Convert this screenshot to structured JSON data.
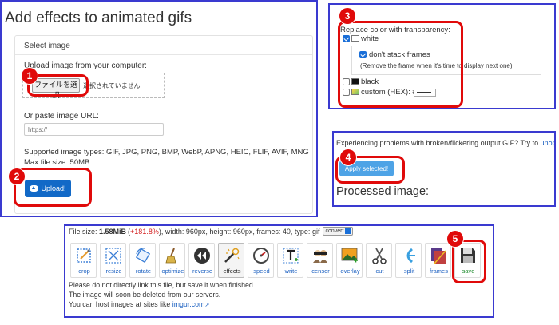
{
  "upload_panel": {
    "title": "Add effects to animated gifs",
    "legend": "Select image",
    "upload_label": "Upload image from your computer:",
    "file_button": "ファイルを選択",
    "file_status": "選択されていません",
    "url_label": "Or paste image URL:",
    "url_placeholder": "https://",
    "supported_types": "Supported image types: GIF, JPG, PNG, BMP, WebP, APNG, HEIC, FLIF, AVIF, MNG",
    "max_size": "Max file size: 50MB",
    "upload_button": "Upload!"
  },
  "transparency_panel": {
    "label": "Replace color with transparency:",
    "white": "white",
    "dont_stack": "don't stack frames",
    "remove_note": "(Remove the frame when it's time to display next one)",
    "black": "black",
    "custom": "custom (HEX): #",
    "checked": {
      "white": true,
      "dont_stack": true,
      "black": false,
      "custom": false
    }
  },
  "apply_panel": {
    "problems_text": "Experiencing problems with broken/flickering output GIF? Try to ",
    "problems_link": "unop",
    "apply_button": "Apply selected!",
    "processed_title": "Processed image:"
  },
  "result_panel": {
    "file_size_label": "File size:",
    "file_size_value": "1.58MiB",
    "size_change": "+181.8%",
    "dimensions_text": ", width: 960px, height: 960px, frames: 40, type: gif",
    "convert_label": "convert",
    "tools": [
      {
        "label": "crop",
        "icon": "crop-icon"
      },
      {
        "label": "resize",
        "icon": "resize-icon"
      },
      {
        "label": "rotate",
        "icon": "rotate-icon"
      },
      {
        "label": "optimize",
        "icon": "optimize-icon"
      },
      {
        "label": "reverse",
        "icon": "reverse-icon"
      },
      {
        "label": "effects",
        "icon": "effects-wand-icon"
      },
      {
        "label": "speed",
        "icon": "speed-icon"
      },
      {
        "label": "write",
        "icon": "write-text-icon"
      },
      {
        "label": "censor",
        "icon": "censor-icon"
      },
      {
        "label": "overlay",
        "icon": "overlay-icon"
      },
      {
        "label": "cut",
        "icon": "scissors-icon"
      },
      {
        "label": "split",
        "icon": "split-icon"
      },
      {
        "label": "frames",
        "icon": "frames-icon"
      },
      {
        "label": "save",
        "icon": "floppy-save-icon"
      }
    ],
    "note1": "Please do not directly link this file, but save it when finished.",
    "note2": "The image will soon be deleted from our servers.",
    "note3_prefix": "You can host images at sites like ",
    "note3_link": "imgur.com"
  },
  "callouts": [
    "1",
    "2",
    "3",
    "4",
    "5"
  ],
  "colors": {
    "panel_border": "#3a3ad0",
    "callout_red": "#e00a0a",
    "upload_blue": "#1269c7",
    "apply_blue": "#4ea3e6",
    "link_blue": "#1a5fc0"
  }
}
